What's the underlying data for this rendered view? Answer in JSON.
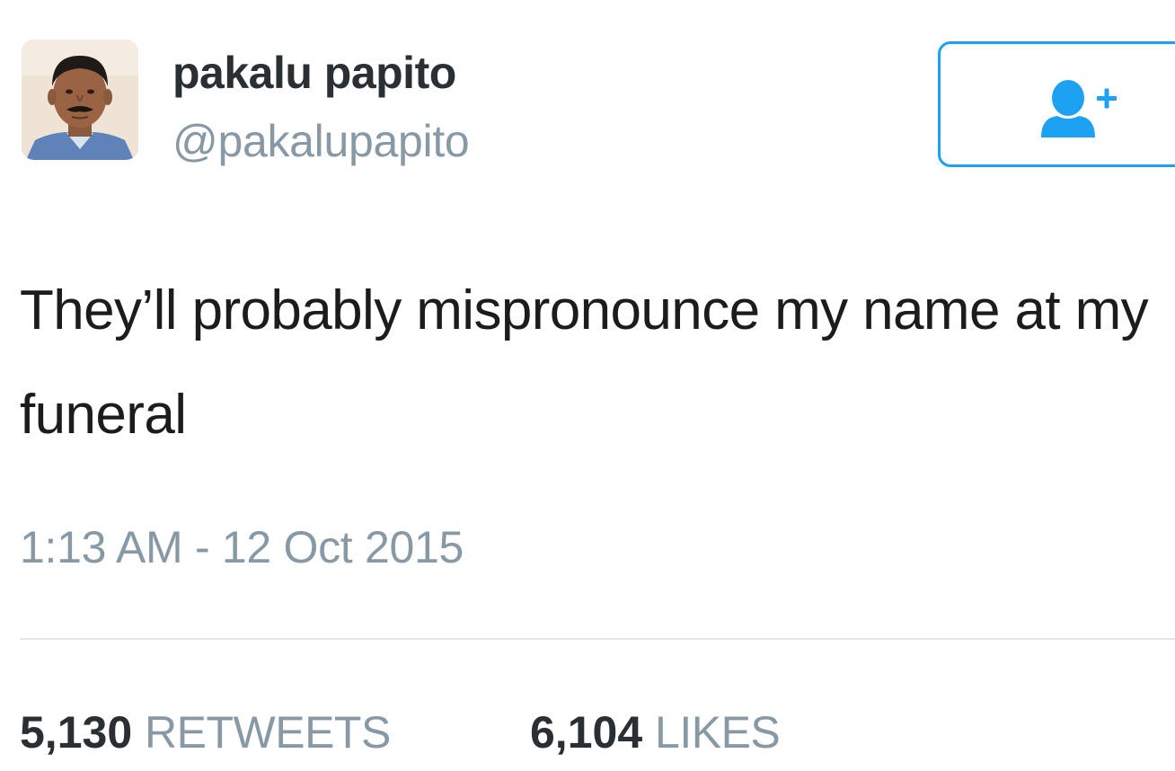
{
  "user": {
    "display_name": "pakalu papito",
    "handle": "@pakalupapito"
  },
  "follow_button": {
    "icon": "follow-user-icon",
    "accent_color": "#1da1f2"
  },
  "tweet": {
    "text": "They’ll probably mispronounce my name at my funeral",
    "timestamp": "1:13 AM - 12 Oct 2015"
  },
  "stats": {
    "retweets": {
      "count": "5,130",
      "label": "RETWEETS"
    },
    "likes": {
      "count": "6,104",
      "label": "LIKES"
    }
  },
  "colors": {
    "text": "#292f33",
    "muted": "#8899a6",
    "accent": "#1da1f2",
    "divider": "#e1e8ed"
  }
}
